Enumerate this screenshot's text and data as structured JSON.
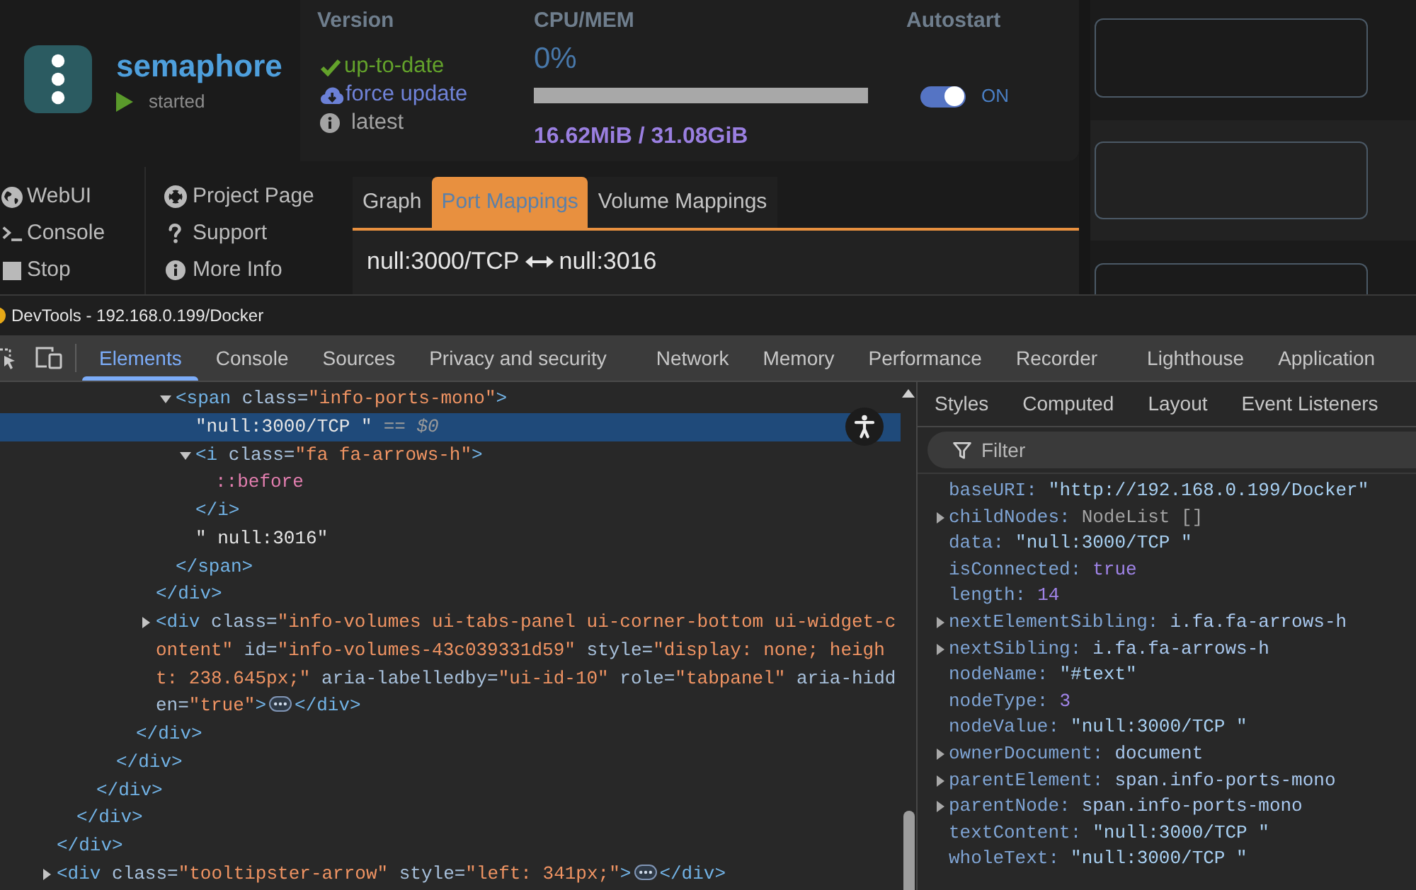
{
  "container": {
    "name": "semaphore",
    "status": "started"
  },
  "info": {
    "version": {
      "heading": "Version",
      "items": [
        {
          "kind": "ok",
          "text": "up-to-date"
        },
        {
          "kind": "action",
          "text": "force update"
        },
        {
          "kind": "info",
          "text": "latest"
        }
      ]
    },
    "usage": {
      "heading": "CPU/MEM",
      "cpu": "0%",
      "memory": "16.62MiB / 31.08GiB"
    },
    "autostart": {
      "heading": "Autostart",
      "on": true,
      "label": "ON"
    }
  },
  "actions": [
    {
      "label": "WebUI"
    },
    {
      "label": "Console"
    },
    {
      "label": "Stop"
    }
  ],
  "links": [
    {
      "label": "Project Page"
    },
    {
      "label": "Support"
    },
    {
      "label": "More Info"
    }
  ],
  "tabs": [
    {
      "label": "Graph",
      "selected": false
    },
    {
      "label": "Port Mappings",
      "selected": true
    },
    {
      "label": "Volume Mappings",
      "selected": false
    }
  ],
  "port_mapping": {
    "container_port": "null:3000/TCP",
    "host_port": "null:3016"
  },
  "devtools": {
    "title": "DevTools - 192.168.0.199/Docker",
    "tabs": [
      {
        "label": "Elements",
        "selected": true
      },
      {
        "label": "Console",
        "selected": false
      },
      {
        "label": "Sources",
        "selected": false
      },
      {
        "label": "Privacy and security",
        "selected": false
      },
      {
        "label": "Network",
        "selected": false
      },
      {
        "label": "Memory",
        "selected": false
      },
      {
        "label": "Performance",
        "selected": false
      },
      {
        "label": "Recorder",
        "selected": false
      },
      {
        "label": "Lighthouse",
        "selected": false
      },
      {
        "label": "Application",
        "selected": false
      }
    ],
    "tree": [
      {
        "kind": "element",
        "selected": false,
        "close": "</div>",
        "children": [
          {
            "kind": "element",
            "selected": false,
            "close": "</div>",
            "children": [
              {
                "kind": "element",
                "selected": false,
                "close": "</div>",
                "children": [
                  {
                    "kind": "element",
                    "selected": false,
                    "close": "</div>",
                    "children": [
                      {
                        "kind": "element",
                        "selected": false,
                        "close": "</div>",
                        "children": [
                          {
                            "kind": "element",
                            "selected": false,
                            "close": "</div>",
                            "children": [
                              {
                                "kind": "element",
                                "selected": false,
                                "expanded": true,
                                "open": [
                                  {
                                    "kind": "tag",
                                    "text": "<span"
                                  },
                                  {
                                    "kind": "attr",
                                    "text": " class="
                                  },
                                  {
                                    "kind": "value",
                                    "text": "\"info-ports-mono\""
                                  },
                                  {
                                    "kind": "tag",
                                    "text": ">"
                                  }
                                ],
                                "close": "</span>",
                                "children": [
                                  {
                                    "kind": "text",
                                    "selected": true,
                                    "text": "\"null:3000/TCP \"",
                                    "note": "== *$0*"
                                  },
                                  {
                                    "kind": "element",
                                    "selected": false,
                                    "expanded": true,
                                    "open": [
                                      {
                                        "kind": "tag",
                                        "text": "<i"
                                      },
                                      {
                                        "kind": "attr",
                                        "text": " class="
                                      },
                                      {
                                        "kind": "value",
                                        "text": "\"fa fa-arrows-h\""
                                      },
                                      {
                                        "kind": "tag",
                                        "text": ">"
                                      }
                                    ],
                                    "close": "</i>",
                                    "children": [
                                      {
                                        "kind": "pseudo",
                                        "selected": false,
                                        "text": "::before"
                                      }
                                    ]
                                  },
                                  {
                                    "kind": "text",
                                    "selected": false,
                                    "text": "\" null:3016\""
                                  }
                                ]
                              }
                            ]
                          },
                          {
                            "kind": "element",
                            "selected": false,
                            "expanded": false,
                            "open": [
                              {
                                "kind": "tag",
                                "text": "<div"
                              },
                              {
                                "kind": "attr",
                                "text": " class="
                              },
                              {
                                "kind": "value",
                                "text": "\"info-volumes ui-tabs-panel ui-corner-bottom ui-widget-content\""
                              },
                              {
                                "kind": "attr",
                                "text": " id="
                              },
                              {
                                "kind": "value",
                                "text": "\"info-volumes-43c039331d59\""
                              },
                              {
                                "kind": "attr",
                                "text": " style="
                              },
                              {
                                "kind": "value",
                                "text": "\"display: none; height: 238.645px;\""
                              },
                              {
                                "kind": "attr",
                                "text": " aria-labelledby="
                              },
                              {
                                "kind": "value",
                                "text": "\"ui-id-10\""
                              },
                              {
                                "kind": "attr",
                                "text": " role="
                              },
                              {
                                "kind": "value",
                                "text": "\"tabpanel\""
                              },
                              {
                                "kind": "attr",
                                "text": " aria-hidden="
                              },
                              {
                                "kind": "value",
                                "text": "\"true\""
                              },
                              {
                                "kind": "tag",
                                "text": ">"
                              }
                            ],
                            "close": "</div>"
                          }
                        ]
                      }
                    ]
                  }
                ]
              }
            ]
          }
        ]
      },
      {
        "kind": "element",
        "selected": false,
        "expanded": false,
        "open": [
          {
            "kind": "tag",
            "text": "<div"
          },
          {
            "kind": "attr",
            "text": " class="
          },
          {
            "kind": "value",
            "text": "\"tooltipster-arrow\""
          },
          {
            "kind": "attr",
            "text": " style="
          },
          {
            "kind": "value",
            "text": "\"left: 341px;\""
          },
          {
            "kind": "tag",
            "text": ">"
          }
        ],
        "close": "</div>"
      }
    ],
    "sidebar_tabs": [
      {
        "label": "Styles"
      },
      {
        "label": "Computed"
      },
      {
        "label": "Layout"
      },
      {
        "label": "Event Listeners"
      }
    ],
    "filter": {
      "placeholder": "Filter"
    },
    "properties": [
      {
        "name": "baseURI:",
        "kind": "string",
        "value": "\"http://192.168.0.199/Docker\""
      },
      {
        "name": "childNodes:",
        "kind": "list",
        "expanded": false,
        "value": "NodeList []"
      },
      {
        "name": "data:",
        "kind": "string",
        "value": "\"null:3000/TCP \""
      },
      {
        "name": "isConnected:",
        "kind": "boolean",
        "value": "true"
      },
      {
        "name": "length:",
        "kind": "number",
        "value": "14"
      },
      {
        "name": "nextElementSibling:",
        "kind": "object",
        "expanded": false,
        "value": "i.fa.fa-arrows-h"
      },
      {
        "name": "nextSibling:",
        "kind": "object",
        "expanded": false,
        "value": "i.fa.fa-arrows-h"
      },
      {
        "name": "nodeName:",
        "kind": "string",
        "value": "\"#text\""
      },
      {
        "name": "nodeType:",
        "kind": "number",
        "value": "3"
      },
      {
        "name": "nodeValue:",
        "kind": "string",
        "value": "\"null:3000/TCP \""
      },
      {
        "name": "ownerDocument:",
        "kind": "object",
        "expanded": false,
        "value": "document"
      },
      {
        "name": "parentElement:",
        "kind": "object",
        "expanded": false,
        "value": "span.info-ports-mono"
      },
      {
        "name": "parentNode:",
        "kind": "object",
        "expanded": false,
        "value": "span.info-ports-mono"
      },
      {
        "name": "textContent:",
        "kind": "string",
        "value": "\"null:3000/TCP \""
      },
      {
        "name": "wholeText:",
        "kind": "string",
        "value": "\"null:3000/TCP \""
      }
    ]
  }
}
